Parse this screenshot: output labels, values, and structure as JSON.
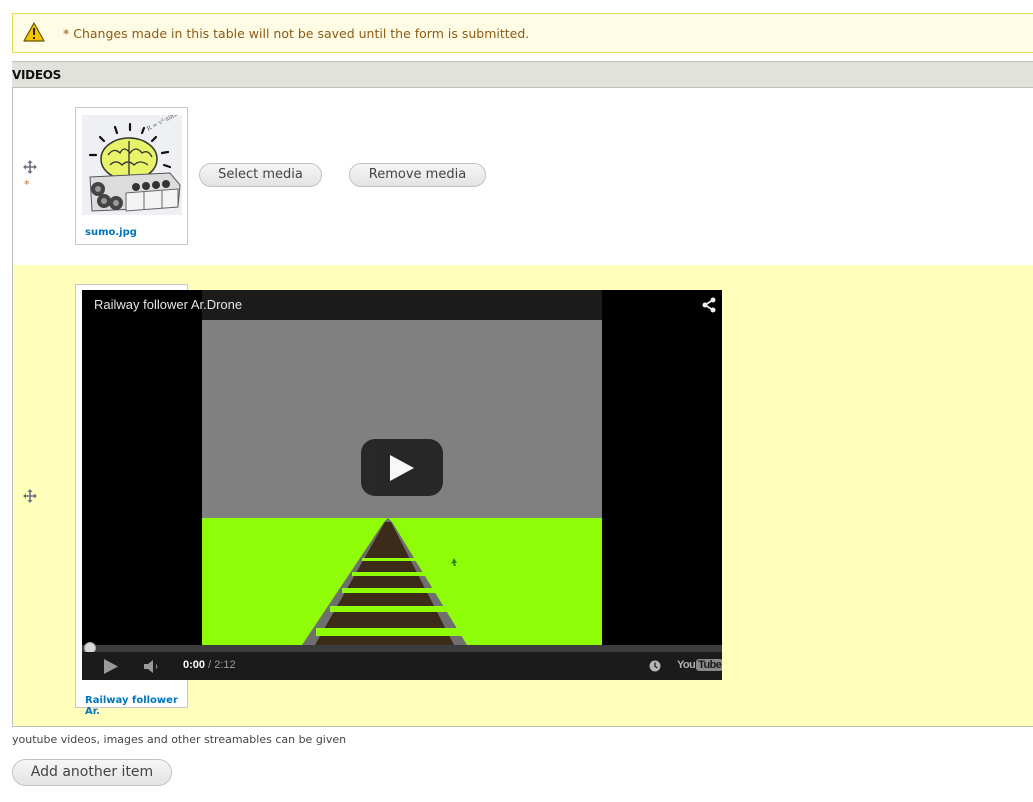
{
  "warning": {
    "icon": "warning-triangle-icon",
    "message": "* Changes made in this table will not be saved until the form is submitted."
  },
  "table": {
    "header": "VIDEOS",
    "rows": [
      {
        "drag_icon": "drag-move-icon",
        "required_marker": "*",
        "media": {
          "type": "image",
          "filename": "sumo.jpg",
          "thumbnail": "brain-on-tracked-robot"
        },
        "buttons": {
          "select": "Select media",
          "remove": "Remove media"
        }
      },
      {
        "drag_icon": "drag-move-icon",
        "media": {
          "type": "youtube-video",
          "label": "Railway follower Ar.",
          "player": {
            "title": "Railway follower Ar.Drone",
            "current_time": "0:00",
            "separator": " / ",
            "duration": "2:12",
            "progress_percent": 0,
            "logo_you": "You",
            "logo_tube": "Tube",
            "icons": [
              "share-icon",
              "play-icon",
              "volume-icon",
              "watch-later-icon",
              "youtube-logo"
            ]
          }
        }
      }
    ]
  },
  "help_text": "youtube videos, images and other streamables can be given",
  "add_button": "Add another item",
  "colors": {
    "warning_bg": "#fffce5",
    "warning_text": "#8c5b14",
    "highlight_row": "#ffffbb",
    "link": "#0074bd",
    "grass": "#8ffc08"
  }
}
